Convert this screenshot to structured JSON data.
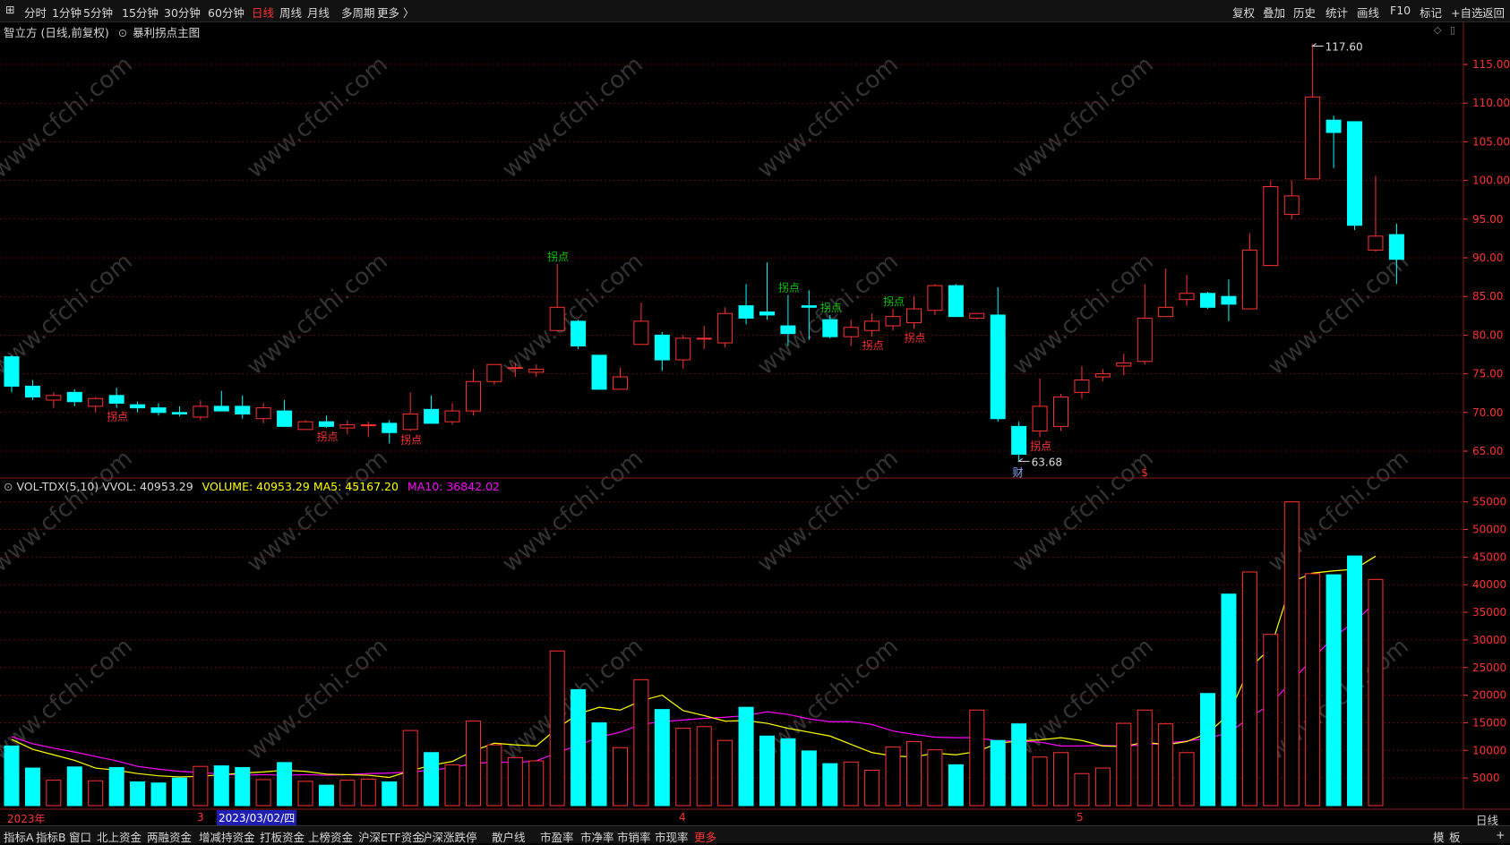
{
  "toolbar": {
    "periods": [
      "分时",
      "1分钟",
      "5分钟",
      "15分钟",
      "30分钟",
      "60分钟",
      "日线",
      "周线",
      "月线",
      "多周期",
      "更多 〉"
    ],
    "active_period": "日线",
    "right": [
      "复权",
      "叠加",
      "历史",
      "统计",
      "画线",
      "F10",
      "标记",
      "+自选",
      "返回"
    ]
  },
  "main_title": {
    "name": "智立方 (日线,前复权)",
    "indicator": "暴利拐点主图"
  },
  "vol_title": {
    "name": "VOL-TDX(5,10)",
    "vvol": "VVOL: 40953.29",
    "volume": "VOLUME: 40953.29",
    "ma5": "MA5: 45167.20",
    "ma10": "MA10: 36842.02"
  },
  "period_label": "日线",
  "bottom_tabs": [
    "指标A",
    "指标B",
    "窗口",
    "北上资金",
    "两融资金",
    "增减持资金",
    "打板资金",
    "上榜资金",
    "沪深ETF资金",
    "沪深涨跌停",
    "散户线",
    "市盈率",
    "市净率",
    "市销率",
    "市现率",
    "更多"
  ],
  "bottom_right": [
    "模",
    "板",
    "+"
  ],
  "timeline": {
    "year": "2023年",
    "m3": "3",
    "cursor_date": "2023/03/02/四",
    "m4": "4",
    "m5": "5"
  },
  "watermark": "www.cfchi.com",
  "markers": {
    "fin": "财",
    "dollar": "$"
  },
  "colors": {
    "up": "#ff3232",
    "down": "#00ffff",
    "ma5": "#ffff00",
    "ma10": "#ff00ff",
    "annotation_green": "#00c800",
    "annotation_red": "#ff3232"
  },
  "chart_data": {
    "type": "candlestick",
    "price_axis": {
      "ticks": [
        65,
        70,
        75,
        80,
        85,
        90,
        95,
        100,
        105,
        110,
        115
      ],
      "tick_labels": [
        "65.00",
        "70.00",
        "75.00",
        "80.00",
        "85.00",
        "90.00",
        "95.00",
        "100.00",
        "105.00",
        "110.00",
        "115.00"
      ]
    },
    "volume_axis": {
      "ticks": [
        5000,
        10000,
        15000,
        20000,
        25000,
        30000,
        35000,
        40000,
        45000,
        50000,
        55000
      ],
      "tick_labels": [
        "5000",
        "10000",
        "15000",
        "20000",
        "25000",
        "30000",
        "35000",
        "40000",
        "45000",
        "50000",
        "55000"
      ]
    },
    "candles": [
      {
        "o": 77.2,
        "h": 77.4,
        "l": 72.6,
        "c": 73.4
      },
      {
        "o": 73.4,
        "h": 74.2,
        "l": 71.6,
        "c": 72.0
      },
      {
        "o": 71.6,
        "h": 72.6,
        "l": 70.6,
        "c": 72.2
      },
      {
        "o": 72.6,
        "h": 73.0,
        "l": 70.8,
        "c": 71.4
      },
      {
        "o": 70.8,
        "h": 72.0,
        "l": 70.0,
        "c": 71.8
      },
      {
        "o": 72.2,
        "h": 73.2,
        "l": 70.6,
        "c": 71.2
      },
      {
        "o": 71.0,
        "h": 71.4,
        "l": 70.0,
        "c": 70.6
      },
      {
        "o": 70.6,
        "h": 71.2,
        "l": 69.6,
        "c": 70.0
      },
      {
        "o": 70.0,
        "h": 70.8,
        "l": 69.5,
        "c": 69.8
      },
      {
        "o": 69.4,
        "h": 71.6,
        "l": 69.0,
        "c": 70.8
      },
      {
        "o": 70.8,
        "h": 72.8,
        "l": 70.2,
        "c": 70.2
      },
      {
        "o": 70.8,
        "h": 72.2,
        "l": 69.2,
        "c": 69.8
      },
      {
        "o": 69.2,
        "h": 71.2,
        "l": 68.6,
        "c": 70.6
      },
      {
        "o": 70.2,
        "h": 71.6,
        "l": 68.2,
        "c": 68.2
      },
      {
        "o": 67.8,
        "h": 69.0,
        "l": 67.8,
        "c": 68.8
      },
      {
        "o": 68.8,
        "h": 69.6,
        "l": 68.0,
        "c": 68.2
      },
      {
        "o": 68.0,
        "h": 69.0,
        "l": 67.2,
        "c": 68.4
      },
      {
        "o": 68.4,
        "h": 68.8,
        "l": 66.8,
        "c": 68.4
      },
      {
        "o": 68.6,
        "h": 69.0,
        "l": 66.0,
        "c": 67.4
      },
      {
        "o": 67.8,
        "h": 72.6,
        "l": 67.6,
        "c": 69.8
      },
      {
        "o": 70.4,
        "h": 72.2,
        "l": 68.6,
        "c": 68.6
      },
      {
        "o": 68.8,
        "h": 71.2,
        "l": 68.4,
        "c": 70.2
      },
      {
        "o": 70.2,
        "h": 75.6,
        "l": 69.6,
        "c": 74.0
      },
      {
        "o": 74.0,
        "h": 76.2,
        "l": 73.6,
        "c": 76.2
      },
      {
        "o": 75.8,
        "h": 76.4,
        "l": 74.6,
        "c": 75.8
      },
      {
        "o": 75.2,
        "h": 76.2,
        "l": 74.6,
        "c": 75.6
      },
      {
        "o": 80.6,
        "h": 89.2,
        "l": 80.6,
        "c": 83.6
      },
      {
        "o": 81.8,
        "h": 82.0,
        "l": 78.2,
        "c": 78.6
      },
      {
        "o": 77.4,
        "h": 77.4,
        "l": 73.0,
        "c": 73.0
      },
      {
        "o": 73.0,
        "h": 75.8,
        "l": 73.0,
        "c": 74.6
      },
      {
        "o": 78.8,
        "h": 84.2,
        "l": 78.8,
        "c": 81.8
      },
      {
        "o": 80.0,
        "h": 80.4,
        "l": 75.4,
        "c": 76.8
      },
      {
        "o": 76.8,
        "h": 80.0,
        "l": 75.6,
        "c": 79.6
      },
      {
        "o": 79.6,
        "h": 81.2,
        "l": 78.2,
        "c": 79.6
      },
      {
        "o": 79.0,
        "h": 83.6,
        "l": 78.4,
        "c": 82.8
      },
      {
        "o": 83.8,
        "h": 86.6,
        "l": 81.4,
        "c": 82.2
      },
      {
        "o": 83.0,
        "h": 89.4,
        "l": 82.0,
        "c": 82.6
      },
      {
        "o": 81.2,
        "h": 85.2,
        "l": 78.6,
        "c": 80.2
      },
      {
        "o": 83.8,
        "h": 85.8,
        "l": 79.4,
        "c": 83.6
      },
      {
        "o": 82.0,
        "h": 82.6,
        "l": 79.6,
        "c": 79.8
      },
      {
        "o": 79.8,
        "h": 82.0,
        "l": 78.6,
        "c": 81.0
      },
      {
        "o": 80.6,
        "h": 82.8,
        "l": 79.8,
        "c": 81.8
      },
      {
        "o": 81.2,
        "h": 83.4,
        "l": 80.6,
        "c": 82.4
      },
      {
        "o": 81.6,
        "h": 85.0,
        "l": 80.8,
        "c": 83.4
      },
      {
        "o": 83.2,
        "h": 86.6,
        "l": 82.6,
        "c": 86.4
      },
      {
        "o": 86.4,
        "h": 86.6,
        "l": 82.4,
        "c": 82.4
      },
      {
        "o": 82.2,
        "h": 82.8,
        "l": 82.0,
        "c": 82.8
      },
      {
        "o": 82.6,
        "h": 86.2,
        "l": 68.8,
        "c": 69.2
      },
      {
        "o": 68.2,
        "h": 68.8,
        "l": 63.68,
        "c": 64.6
      },
      {
        "o": 67.6,
        "h": 74.4,
        "l": 66.8,
        "c": 70.8
      },
      {
        "o": 68.2,
        "h": 72.4,
        "l": 67.6,
        "c": 72.0
      },
      {
        "o": 72.6,
        "h": 76.0,
        "l": 71.8,
        "c": 74.2
      },
      {
        "o": 74.6,
        "h": 75.6,
        "l": 74.0,
        "c": 75.0
      },
      {
        "o": 76.0,
        "h": 77.6,
        "l": 74.8,
        "c": 76.4
      },
      {
        "o": 76.6,
        "h": 86.6,
        "l": 76.2,
        "c": 82.2
      },
      {
        "o": 82.4,
        "h": 88.6,
        "l": 82.4,
        "c": 83.6
      },
      {
        "o": 84.6,
        "h": 87.8,
        "l": 83.8,
        "c": 85.4
      },
      {
        "o": 85.4,
        "h": 85.6,
        "l": 83.4,
        "c": 83.6
      },
      {
        "o": 85.0,
        "h": 87.2,
        "l": 81.8,
        "c": 84.0
      },
      {
        "o": 83.4,
        "h": 93.2,
        "l": 83.4,
        "c": 91.0
      },
      {
        "o": 89.0,
        "h": 100.0,
        "l": 89.0,
        "c": 99.2
      },
      {
        "o": 95.6,
        "h": 100.0,
        "l": 95.0,
        "c": 98.0
      },
      {
        "o": 100.2,
        "h": 117.6,
        "l": 100.2,
        "c": 110.8
      },
      {
        "o": 107.8,
        "h": 108.4,
        "l": 101.6,
        "c": 106.2
      },
      {
        "o": 107.6,
        "h": 107.6,
        "l": 93.6,
        "c": 94.2
      },
      {
        "o": 91.0,
        "h": 100.6,
        "l": 90.8,
        "c": 92.8
      },
      {
        "o": 93.0,
        "h": 94.4,
        "l": 86.6,
        "c": 89.8
      }
    ],
    "volume": [
      10800,
      6800,
      4600,
      7000,
      4500,
      6900,
      4300,
      4100,
      5000,
      7100,
      7200,
      6900,
      4700,
      7800,
      4400,
      3700,
      4600,
      4800,
      4300,
      13600,
      9600,
      7400,
      15300,
      11000,
      8700,
      8100,
      28000,
      21000,
      15000,
      10500,
      22800,
      17400,
      14000,
      14300,
      11800,
      17800,
      12600,
      12100,
      9900,
      7600,
      7900,
      6400,
      10600,
      11600,
      10100,
      7400,
      17300,
      11800,
      14800,
      8800,
      9600,
      5800,
      6800,
      14900,
      17300,
      14800,
      9600,
      20300,
      38300,
      42300,
      31000,
      55000,
      42000,
      41800,
      45200,
      40953.29
    ],
    "ma5": [
      12000,
      10200,
      9200,
      8200,
      6800,
      6400,
      5800,
      5400,
      5200,
      5300,
      5600,
      5900,
      6100,
      6400,
      6200,
      5700,
      5600,
      5500,
      5100,
      6300,
      7300,
      8000,
      9900,
      11300,
      11000,
      10800,
      14000,
      16600,
      17800,
      17300,
      19000,
      20000,
      17200,
      16300,
      15300,
      15400,
      14900,
      14000,
      13300,
      12600,
      11100,
      9600,
      9000,
      8800,
      9500,
      9200,
      9800,
      11300,
      11700,
      11900,
      12300,
      11800,
      10800,
      10700,
      11500,
      11000,
      11600,
      13100,
      16500,
      25000,
      28500,
      40500,
      42100,
      42500,
      42800,
      45167.2
    ],
    "ma10": [
      12500,
      11200,
      10400,
      9700,
      8900,
      8100,
      7100,
      6600,
      6200,
      6000,
      5700,
      5500,
      5600,
      5500,
      5600,
      5500,
      5600,
      5800,
      5900,
      6100,
      6400,
      6900,
      7600,
      7900,
      7800,
      8100,
      9600,
      10900,
      12400,
      13300,
      14700,
      15200,
      15500,
      15800,
      16000,
      16300,
      17000,
      16500,
      15700,
      15200,
      15200,
      14700,
      13500,
      12900,
      12400,
      12300,
      12300,
      11700,
      11700,
      11500,
      10800,
      10800,
      10900,
      10800,
      11000,
      11300,
      11700,
      12200,
      13200,
      15900,
      18400,
      22500,
      26600,
      30500,
      33300,
      36842.02
    ],
    "extremes": {
      "high_label": "117.60",
      "low_label": "63.68"
    },
    "annotations": [
      {
        "i": 5,
        "text": "拐点",
        "color": "red",
        "pos": "below"
      },
      {
        "i": 15,
        "text": "拐点",
        "color": "red",
        "pos": "below"
      },
      {
        "i": 19,
        "text": "拐点",
        "color": "red",
        "pos": "below"
      },
      {
        "i": 26,
        "text": "拐点",
        "color": "green",
        "pos": "above"
      },
      {
        "i": 37,
        "text": "拐点",
        "color": "green",
        "pos": "above"
      },
      {
        "i": 39,
        "text": "拐点",
        "color": "green",
        "pos": "above"
      },
      {
        "i": 41,
        "text": "拐点",
        "color": "red",
        "pos": "below"
      },
      {
        "i": 42,
        "text": "拐点",
        "color": "green",
        "pos": "above"
      },
      {
        "i": 43,
        "text": "拐点",
        "color": "red",
        "pos": "below"
      },
      {
        "i": 49,
        "text": "拐点",
        "color": "red",
        "pos": "below"
      }
    ]
  }
}
